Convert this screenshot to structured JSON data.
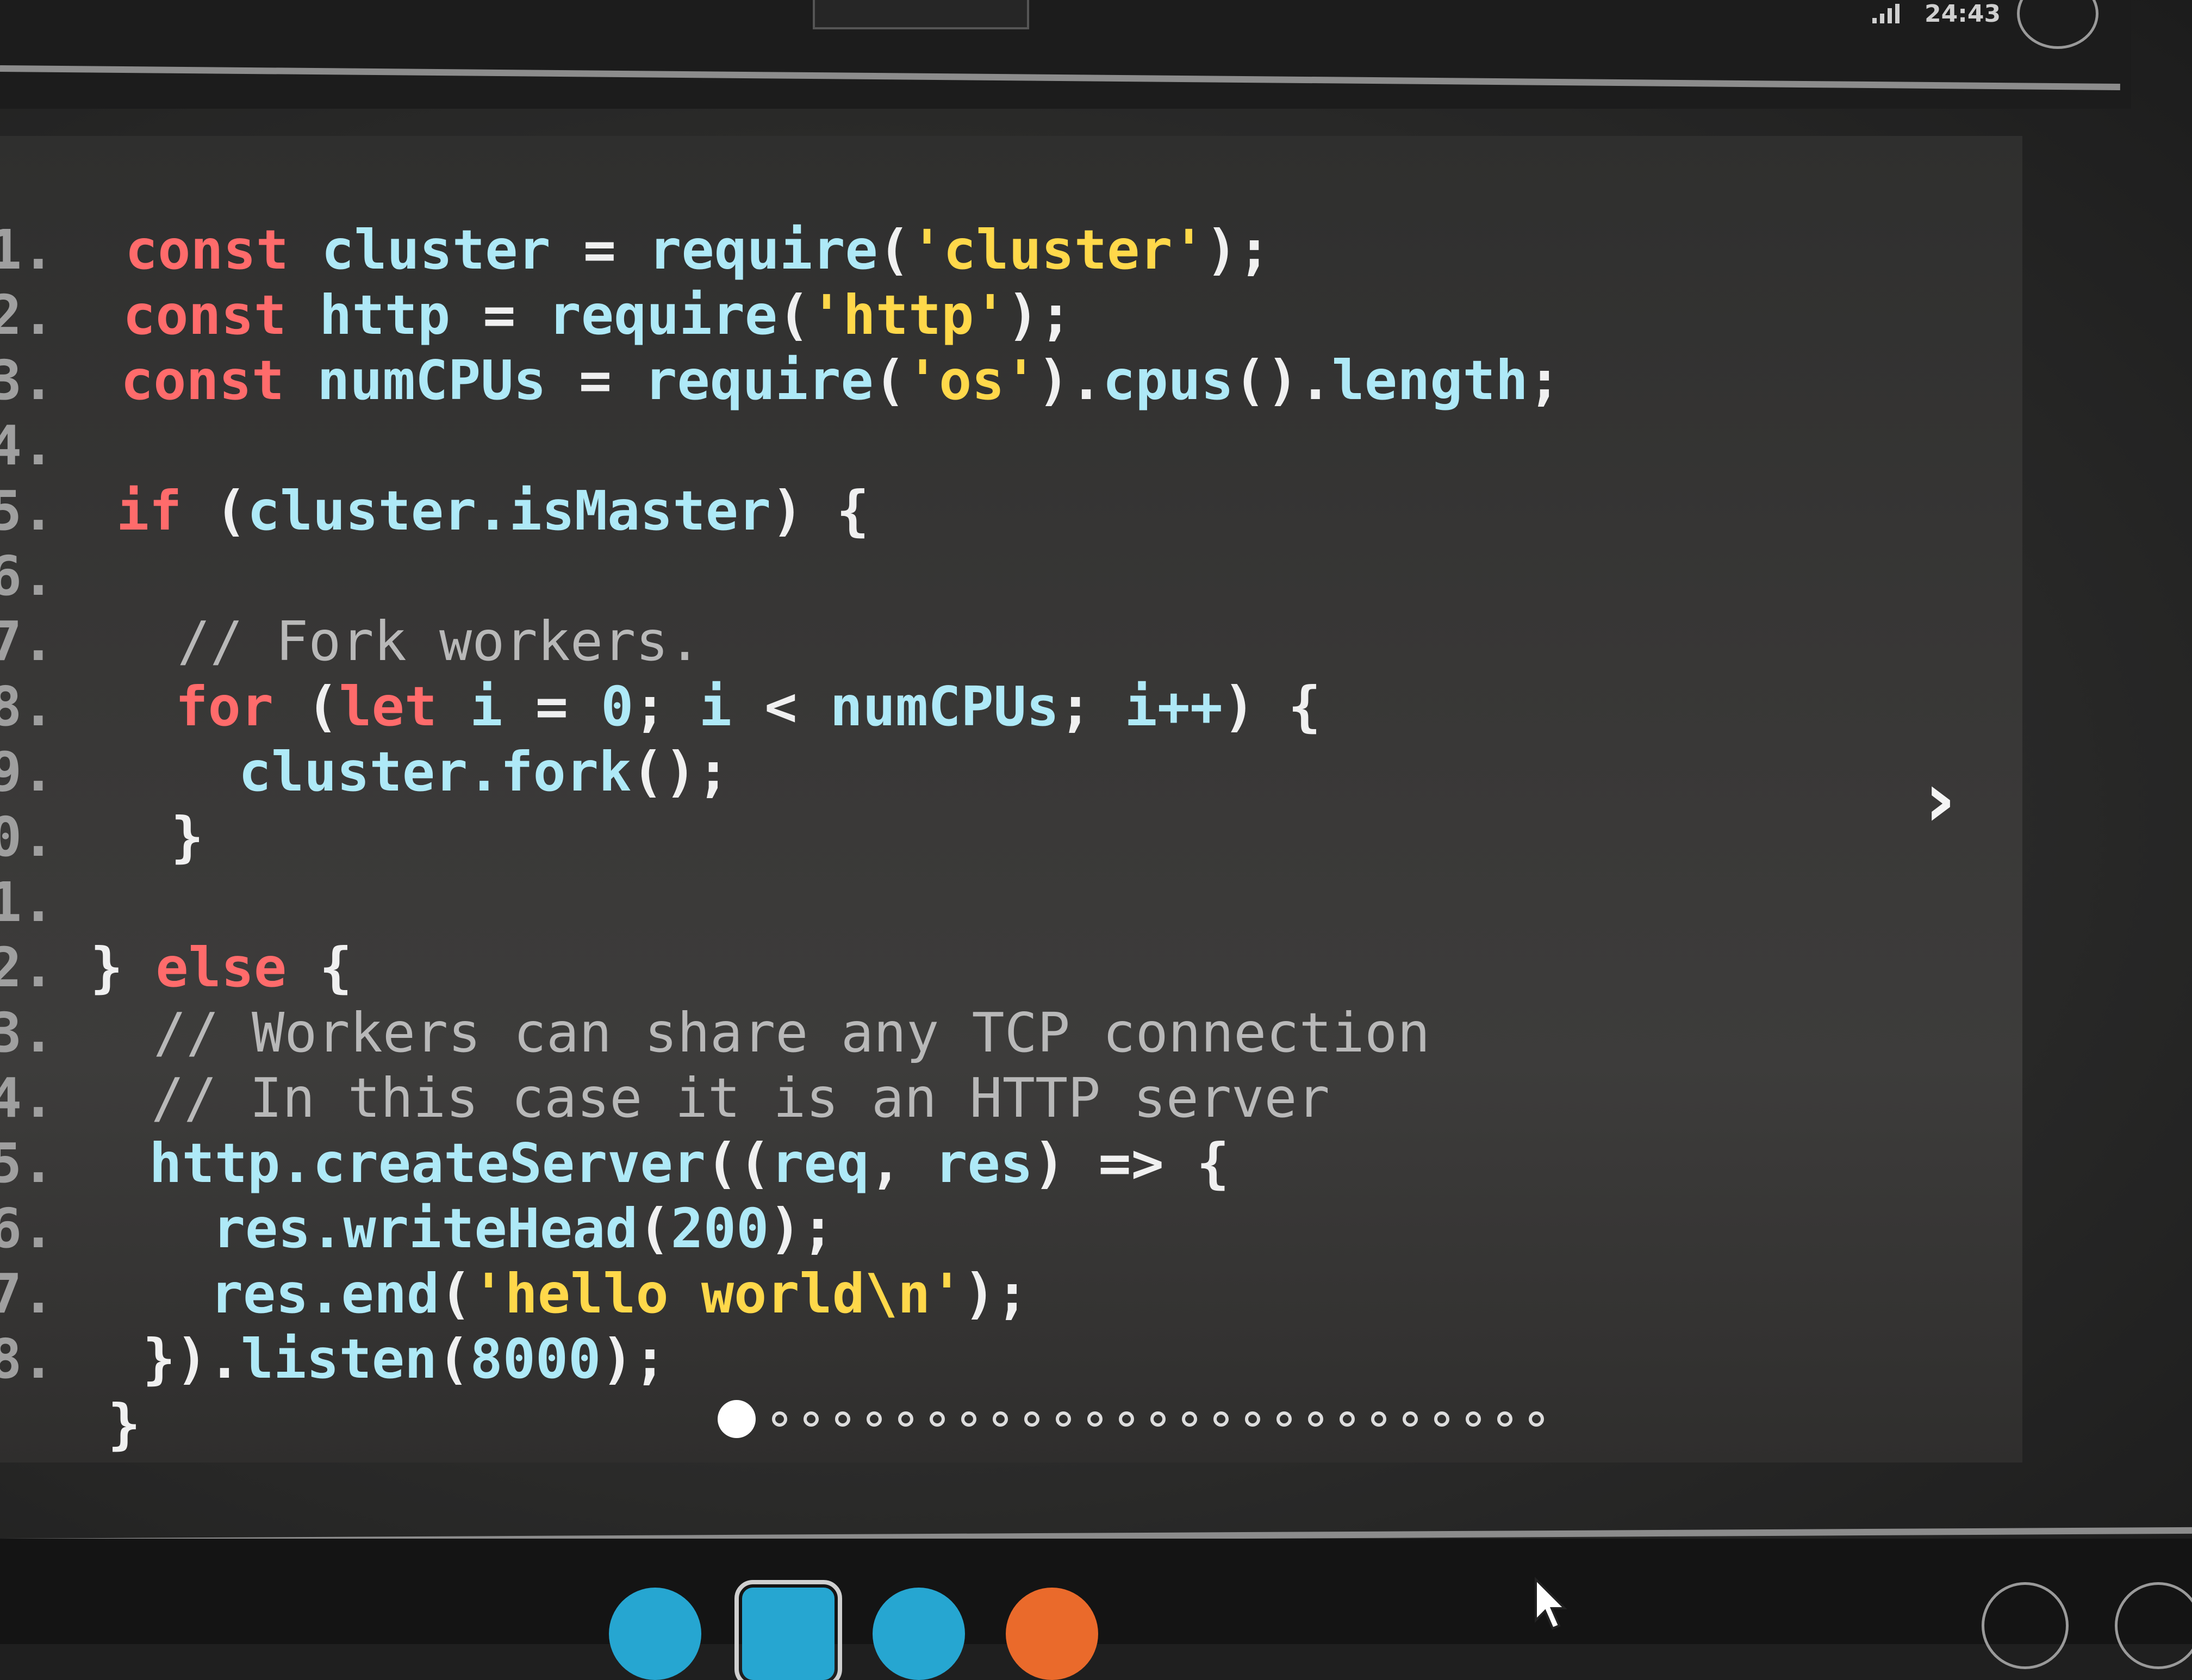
{
  "status_bar": {
    "time": "24:43"
  },
  "code_lines": [
    {
      "n": "1.",
      "segments": [
        {
          "c": "kw",
          "t": "const "
        },
        {
          "c": "id",
          "t": "cluster "
        },
        {
          "c": "op",
          "t": "= "
        },
        {
          "c": "id",
          "t": "require"
        },
        {
          "c": "op",
          "t": "("
        },
        {
          "c": "st",
          "t": "'cluster'"
        },
        {
          "c": "op",
          "t": ");"
        }
      ]
    },
    {
      "n": "2.",
      "segments": [
        {
          "c": "kw",
          "t": "const "
        },
        {
          "c": "id",
          "t": "http "
        },
        {
          "c": "op",
          "t": "= "
        },
        {
          "c": "id",
          "t": "require"
        },
        {
          "c": "op",
          "t": "("
        },
        {
          "c": "st",
          "t": "'http'"
        },
        {
          "c": "op",
          "t": ");"
        }
      ]
    },
    {
      "n": "3.",
      "segments": [
        {
          "c": "kw",
          "t": "const "
        },
        {
          "c": "id",
          "t": "numCPUs "
        },
        {
          "c": "op",
          "t": "= "
        },
        {
          "c": "id",
          "t": "require"
        },
        {
          "c": "op",
          "t": "("
        },
        {
          "c": "st",
          "t": "'os'"
        },
        {
          "c": "op",
          "t": ")."
        },
        {
          "c": "id",
          "t": "cpus"
        },
        {
          "c": "op",
          "t": "()."
        },
        {
          "c": "id",
          "t": "length"
        },
        {
          "c": "op",
          "t": ";"
        }
      ]
    },
    {
      "n": "4.",
      "segments": []
    },
    {
      "n": "5.",
      "segments": [
        {
          "c": "kw",
          "t": "if "
        },
        {
          "c": "op",
          "t": "("
        },
        {
          "c": "id",
          "t": "cluster.isMaster"
        },
        {
          "c": "op",
          "t": ") {"
        }
      ]
    },
    {
      "n": "6.",
      "segments": []
    },
    {
      "n": "7.",
      "segments": [
        {
          "c": "cm",
          "t": "  // Fork workers."
        }
      ]
    },
    {
      "n": "8.",
      "segments": [
        {
          "c": "op",
          "t": "  "
        },
        {
          "c": "kw",
          "t": "for "
        },
        {
          "c": "op",
          "t": "("
        },
        {
          "c": "kw",
          "t": "let "
        },
        {
          "c": "id",
          "t": "i "
        },
        {
          "c": "op",
          "t": "= "
        },
        {
          "c": "id",
          "t": "0"
        },
        {
          "c": "op",
          "t": "; "
        },
        {
          "c": "id",
          "t": "i "
        },
        {
          "c": "op",
          "t": "< "
        },
        {
          "c": "id",
          "t": "numCPUs"
        },
        {
          "c": "op",
          "t": "; "
        },
        {
          "c": "id",
          "t": "i++"
        },
        {
          "c": "op",
          "t": ") {"
        }
      ]
    },
    {
      "n": "9.",
      "segments": [
        {
          "c": "op",
          "t": "    "
        },
        {
          "c": "id",
          "t": "cluster.fork"
        },
        {
          "c": "op",
          "t": "();"
        }
      ]
    },
    {
      "n": "0.",
      "segments": [
        {
          "c": "op",
          "t": "  }"
        }
      ]
    },
    {
      "n": "1.",
      "segments": []
    },
    {
      "n": "2.",
      "segments": [
        {
          "c": "op",
          "t": "} "
        },
        {
          "c": "kw",
          "t": "else "
        },
        {
          "c": "op",
          "t": "{"
        }
      ]
    },
    {
      "n": "3.",
      "segments": [
        {
          "c": "cm",
          "t": "  // Workers can share any TCP connection"
        }
      ]
    },
    {
      "n": "4.",
      "segments": [
        {
          "c": "cm",
          "t": "  // In this case it is an HTTP server"
        }
      ]
    },
    {
      "n": "5.",
      "segments": [
        {
          "c": "op",
          "t": "  "
        },
        {
          "c": "id",
          "t": "http.createServer"
        },
        {
          "c": "op",
          "t": "(("
        },
        {
          "c": "id",
          "t": "req"
        },
        {
          "c": "op",
          "t": ", "
        },
        {
          "c": "id",
          "t": "res"
        },
        {
          "c": "op",
          "t": ") => {"
        }
      ]
    },
    {
      "n": "6.",
      "segments": [
        {
          "c": "op",
          "t": "    "
        },
        {
          "c": "id",
          "t": "res.writeHead"
        },
        {
          "c": "op",
          "t": "("
        },
        {
          "c": "id",
          "t": "200"
        },
        {
          "c": "op",
          "t": ");"
        }
      ]
    },
    {
      "n": "7.",
      "segments": [
        {
          "c": "op",
          "t": "    "
        },
        {
          "c": "id",
          "t": "res.end"
        },
        {
          "c": "op",
          "t": "("
        },
        {
          "c": "st",
          "t": "'hello world\\n'"
        },
        {
          "c": "op",
          "t": ");"
        }
      ]
    },
    {
      "n": "8.",
      "segments": [
        {
          "c": "op",
          "t": "  })."
        },
        {
          "c": "id",
          "t": "listen"
        },
        {
          "c": "op",
          "t": "("
        },
        {
          "c": "id",
          "t": "8000"
        },
        {
          "c": "op",
          "t": ");"
        }
      ]
    },
    {
      "n": "",
      "segments": [
        {
          "c": "op",
          "t": " }"
        }
      ]
    }
  ],
  "pager": {
    "total_slides": 26,
    "active_index": 0
  },
  "next_arrow": "›",
  "colors": {
    "keyword": "#ff6b6b",
    "identifier": "#aee9f7",
    "string": "#ffd84a",
    "comment": "#b8b8b8"
  }
}
